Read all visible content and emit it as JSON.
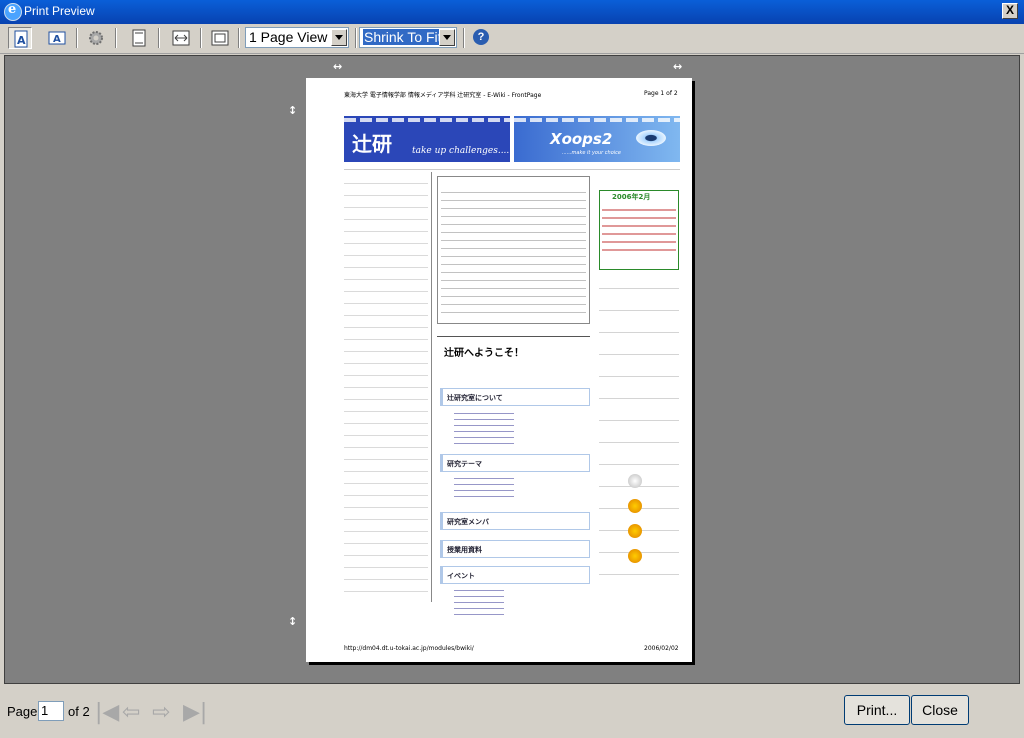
{
  "window": {
    "title": "Print Preview",
    "close_symbol": "X"
  },
  "toolbar": {
    "view_select": "1 Page View",
    "shrink_select": "Shrink To Fit",
    "help_symbol": "?"
  },
  "page": {
    "header_left": "東海大学 電子情報学部 情報メディア学科 辻研究室 - E-Wiki - FrontPage",
    "header_right": "Page 1 of 2",
    "banner_left": "辻研",
    "banner_left_tag": "take up challenges....",
    "banner_right": "Xoops2",
    "banner_right_tag": "......make it your choice",
    "welcome": "辻研へようこそ！",
    "calendar_title": "2006年2月",
    "sections": [
      "辻研究室について",
      "研究テーマ",
      "研究室メンバ",
      "授業用資料",
      "イベント"
    ],
    "footer_left": "http://dm04.dt.u-tokai.ac.jp/modules/bwiki/",
    "footer_right": "2006/02/02"
  },
  "bottom": {
    "page_label": "Page",
    "page_value": "1",
    "page_of": "of 2",
    "print_label": "Print...",
    "close_label": "Close"
  }
}
